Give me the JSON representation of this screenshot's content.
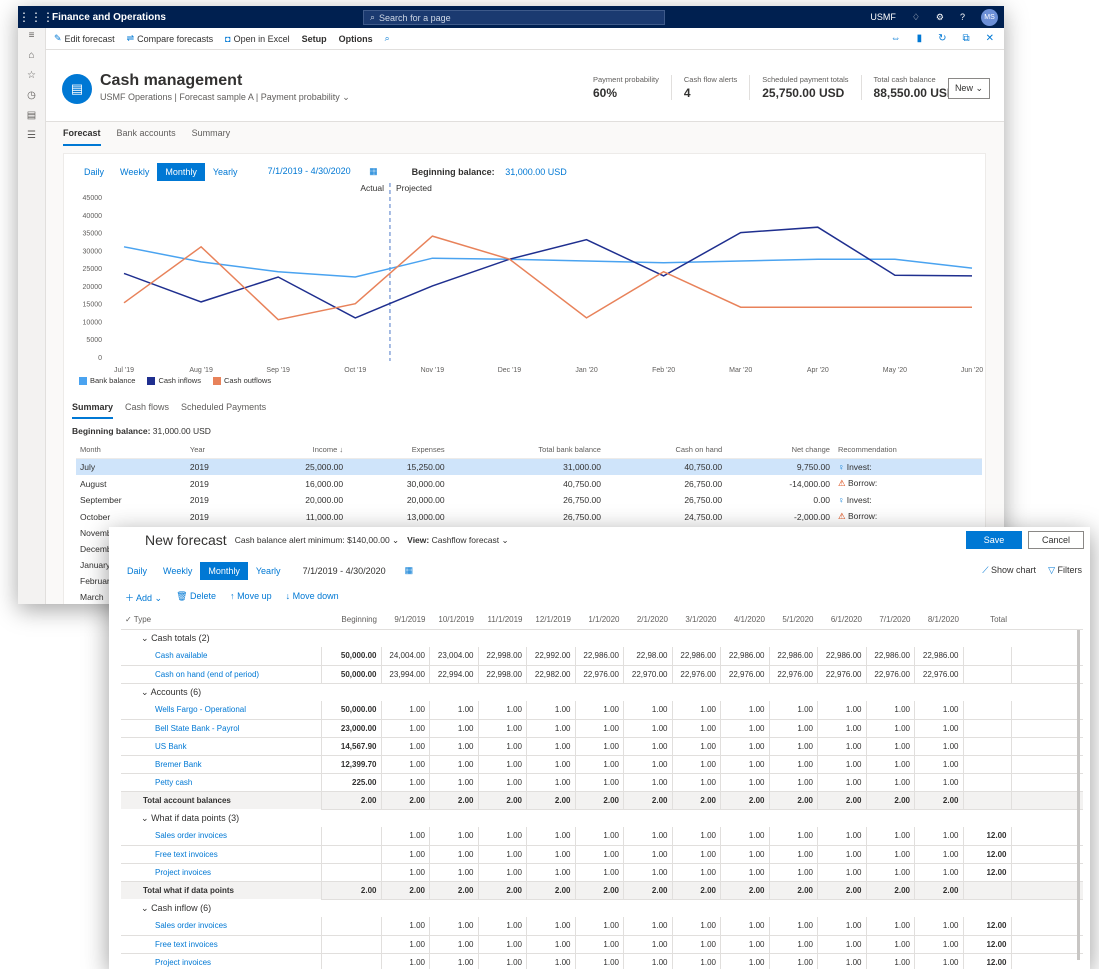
{
  "app": {
    "name": "Finance and Operations",
    "search_placeholder": "Search for a page",
    "company": "USMF",
    "user": "MS"
  },
  "actions": {
    "edit": "Edit forecast",
    "compare": "Compare forecasts",
    "excel": "Open in Excel",
    "setup": "Setup",
    "options": "Options"
  },
  "header": {
    "title": "Cash management",
    "subtitle": "USMF Operations | Forecast sample A | Payment probability",
    "kpis": [
      {
        "label": "Payment probability",
        "value": "60%"
      },
      {
        "label": "Cash flow alerts",
        "value": "4"
      },
      {
        "label": "Scheduled payment totals",
        "value": "25,750.00 USD"
      },
      {
        "label": "Total cash balance",
        "value": "88,550.00 USD"
      }
    ],
    "new_label": "New"
  },
  "tabs": [
    "Forecast",
    "Bank accounts",
    "Summary"
  ],
  "periods": [
    "Daily",
    "Weekly",
    "Monthly",
    "Yearly"
  ],
  "date_range": "7/1/2019 - 4/30/2020",
  "beginning_label": "Beginning balance:",
  "beginning_value": "31,000.00 USD",
  "chart_data": {
    "type": "line",
    "categories": [
      "Jul '19",
      "Aug '19",
      "Sep '19",
      "Oct '19",
      "Nov '19",
      "Dec '19",
      "Jan '20",
      "Feb '20",
      "Mar '20",
      "Apr '20",
      "May '20",
      "Jun '20"
    ],
    "ylim": [
      0,
      45000
    ],
    "yticks": [
      0,
      5000,
      10000,
      15000,
      20000,
      25000,
      30000,
      35000,
      40000,
      45000
    ],
    "annotation_actual": "Actual",
    "annotation_projected": "Projected",
    "divider_after_index": 3.45,
    "series": [
      {
        "name": "Bank balance",
        "color": "#4aa3f0",
        "values": [
          31000,
          26750,
          24000,
          22500,
          27800,
          27500,
          27000,
          26500,
          27000,
          27500,
          27500,
          25000
        ]
      },
      {
        "name": "Cash inflows",
        "color": "#1f2f8f",
        "values": [
          23500,
          15500,
          22500,
          11000,
          20000,
          27500,
          33000,
          22800,
          35000,
          36500,
          23000,
          22800
        ]
      },
      {
        "name": "Cash outflows",
        "color": "#e8825a",
        "values": [
          15250,
          31000,
          10500,
          15000,
          34000,
          27500,
          11000,
          24000,
          14000,
          14000,
          14000,
          14000
        ]
      }
    ],
    "legend": "bottom-left"
  },
  "subtabs": [
    "Summary",
    "Cash flows",
    "Scheduled Payments"
  ],
  "summary": {
    "headers": [
      "Month",
      "Year",
      "Income ↓",
      "Expenses",
      "Total bank balance",
      "Cash on hand",
      "Net change",
      "Recommendation"
    ],
    "rows": [
      [
        "July",
        "2019",
        "25,000.00",
        "15,250.00",
        "31,000.00",
        "40,750.00",
        "9,750.00",
        "Invest:"
      ],
      [
        "August",
        "2019",
        "16,000.00",
        "30,000.00",
        "40,750.00",
        "26,750.00",
        "-14,000.00",
        "Borrow:"
      ],
      [
        "September",
        "2019",
        "20,000.00",
        "20,000.00",
        "26,750.00",
        "26,750.00",
        "0.00",
        "Invest:"
      ],
      [
        "October",
        "2019",
        "11,000.00",
        "13,000.00",
        "26,750.00",
        "24,750.00",
        "-2,000.00",
        "Borrow:"
      ],
      [
        "November",
        "",
        "",
        "",
        "",
        "",
        "",
        ""
      ],
      [
        "December",
        "",
        "",
        "",
        "",
        "",
        "",
        ""
      ],
      [
        "January",
        "",
        "",
        "",
        "",
        "",
        "",
        ""
      ],
      [
        "February",
        "",
        "",
        "",
        "",
        "",
        "",
        ""
      ],
      [
        "March",
        "",
        "",
        "",
        "",
        "",
        "",
        ""
      ]
    ]
  },
  "newforecast": {
    "title": "New forecast",
    "alert_label": "Cash balance alert minimum: $140,00.00",
    "view_label": "View:",
    "view_value": "Cashflow forecast",
    "save": "Save",
    "cancel": "Cancel",
    "show_chart": "Show chart",
    "filters": "Filters",
    "toolbar": [
      "Add",
      "Delete",
      "Move up",
      "Move down"
    ],
    "columns": [
      "Type",
      "Beginning",
      "9/1/2019",
      "10/1/2019",
      "11/1/2019",
      "12/1/2019",
      "1/1/2020",
      "2/1/2020",
      "3/1/2020",
      "4/1/2020",
      "5/1/2020",
      "6/1/2020",
      "7/1/2020",
      "8/1/2020",
      "Total"
    ],
    "rows": [
      {
        "kind": "group",
        "label": "Cash totals (2)"
      },
      {
        "kind": "item",
        "label": "Cash available",
        "begin": "50,000.00",
        "vals": [
          "24,004.00",
          "23,004.00",
          "22,998.00",
          "22,992.00",
          "22,986.00",
          "22,98.00",
          "22,986.00",
          "22,986.00",
          "22,986.00",
          "22,986.00",
          "22,986.00",
          "22,986.00"
        ],
        "total": ""
      },
      {
        "kind": "item",
        "label": "Cash on hand (end of period)",
        "begin": "50,000.00",
        "vals": [
          "23,994.00",
          "22,994.00",
          "22,998.00",
          "22,982.00",
          "22,976.00",
          "22,970.00",
          "22,976.00",
          "22,976.00",
          "22,976.00",
          "22,976.00",
          "22,976.00",
          "22,976.00"
        ],
        "total": ""
      },
      {
        "kind": "group",
        "label": "Accounts (6)"
      },
      {
        "kind": "item",
        "label": "Wells Fargo - Operational",
        "begin": "50,000.00",
        "vals": [
          "1.00",
          "1.00",
          "1.00",
          "1.00",
          "1.00",
          "1.00",
          "1.00",
          "1.00",
          "1.00",
          "1.00",
          "1.00",
          "1.00"
        ],
        "total": ""
      },
      {
        "kind": "item",
        "label": "Bell State Bank - Payrol",
        "begin": "23,000.00",
        "vals": [
          "1.00",
          "1.00",
          "1.00",
          "1.00",
          "1.00",
          "1.00",
          "1.00",
          "1.00",
          "1.00",
          "1.00",
          "1.00",
          "1.00"
        ],
        "total": ""
      },
      {
        "kind": "item",
        "label": "US Bank",
        "begin": "14,567.90",
        "vals": [
          "1.00",
          "1.00",
          "1.00",
          "1.00",
          "1.00",
          "1.00",
          "1.00",
          "1.00",
          "1.00",
          "1.00",
          "1.00",
          "1.00"
        ],
        "total": ""
      },
      {
        "kind": "item",
        "label": "Bremer Bank",
        "begin": "12,399.70",
        "vals": [
          "1.00",
          "1.00",
          "1.00",
          "1.00",
          "1.00",
          "1.00",
          "1.00",
          "1.00",
          "1.00",
          "1.00",
          "1.00",
          "1.00"
        ],
        "total": ""
      },
      {
        "kind": "item",
        "label": "Petty cash",
        "begin": "225.00",
        "vals": [
          "1.00",
          "1.00",
          "1.00",
          "1.00",
          "1.00",
          "1.00",
          "1.00",
          "1.00",
          "1.00",
          "1.00",
          "1.00",
          "1.00"
        ],
        "total": ""
      },
      {
        "kind": "total",
        "label": "Total account balances",
        "begin": "2.00",
        "vals": [
          "2.00",
          "2.00",
          "2.00",
          "2.00",
          "2.00",
          "2.00",
          "2.00",
          "2.00",
          "2.00",
          "2.00",
          "2.00",
          "2.00"
        ],
        "total": ""
      },
      {
        "kind": "group",
        "label": "What if data points (3)"
      },
      {
        "kind": "item",
        "label": "Sales order invoices",
        "begin": "",
        "vals": [
          "1.00",
          "1.00",
          "1.00",
          "1.00",
          "1.00",
          "1.00",
          "1.00",
          "1.00",
          "1.00",
          "1.00",
          "1.00",
          "1.00"
        ],
        "total": "12.00"
      },
      {
        "kind": "item",
        "label": "Free text invoices",
        "begin": "",
        "vals": [
          "1.00",
          "1.00",
          "1.00",
          "1.00",
          "1.00",
          "1.00",
          "1.00",
          "1.00",
          "1.00",
          "1.00",
          "1.00",
          "1.00"
        ],
        "total": "12.00"
      },
      {
        "kind": "item",
        "label": "Project invoices",
        "begin": "",
        "vals": [
          "1.00",
          "1.00",
          "1.00",
          "1.00",
          "1.00",
          "1.00",
          "1.00",
          "1.00",
          "1.00",
          "1.00",
          "1.00",
          "1.00"
        ],
        "total": "12.00"
      },
      {
        "kind": "total",
        "label": "Total what if data points",
        "begin": "2.00",
        "vals": [
          "2.00",
          "2.00",
          "2.00",
          "2.00",
          "2.00",
          "2.00",
          "2.00",
          "2.00",
          "2.00",
          "2.00",
          "2.00",
          "2.00"
        ],
        "total": ""
      },
      {
        "kind": "group",
        "label": "Cash inflow (6)"
      },
      {
        "kind": "item",
        "label": "Sales order invoices",
        "begin": "",
        "vals": [
          "1.00",
          "1.00",
          "1.00",
          "1.00",
          "1.00",
          "1.00",
          "1.00",
          "1.00",
          "1.00",
          "1.00",
          "1.00",
          "1.00"
        ],
        "total": "12.00"
      },
      {
        "kind": "item",
        "label": "Free text invoices",
        "begin": "",
        "vals": [
          "1.00",
          "1.00",
          "1.00",
          "1.00",
          "1.00",
          "1.00",
          "1.00",
          "1.00",
          "1.00",
          "1.00",
          "1.00",
          "1.00"
        ],
        "total": "12.00"
      },
      {
        "kind": "item",
        "label": "Project invoices",
        "begin": "",
        "vals": [
          "1.00",
          "1.00",
          "1.00",
          "1.00",
          "1.00",
          "1.00",
          "1.00",
          "1.00",
          "1.00",
          "1.00",
          "1.00",
          "1.00"
        ],
        "total": "12.00"
      }
    ]
  }
}
